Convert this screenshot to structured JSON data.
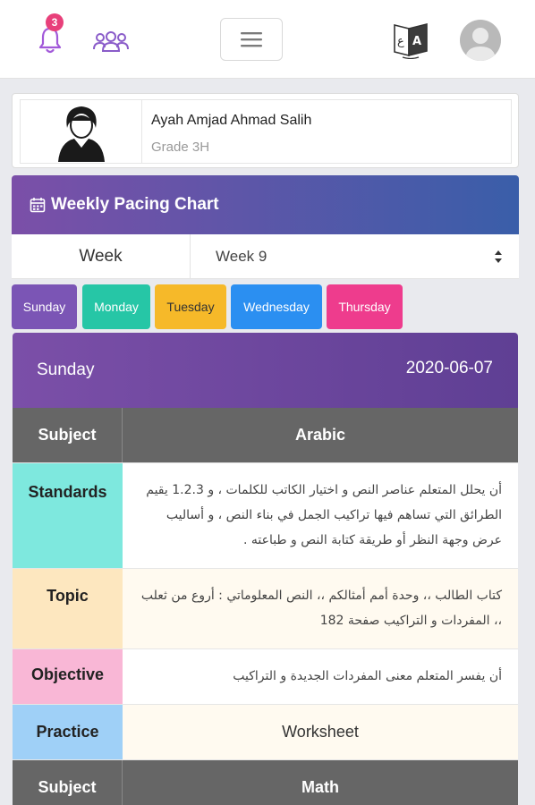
{
  "header": {
    "notification_count": "3",
    "icons": [
      "bell-icon",
      "group-icon",
      "menu-icon",
      "language-icon",
      "avatar-icon"
    ]
  },
  "student": {
    "name": "Ayah Amjad Ahmad Salih",
    "grade": "Grade 3H"
  },
  "chart": {
    "title": "Weekly Pacing Chart",
    "week_label": "Week",
    "week_selected": "Week 9"
  },
  "days": [
    {
      "label": "Sunday",
      "color": "#7b55b5",
      "text_color": "#ffffff"
    },
    {
      "label": "Monday",
      "color": "#26c6a6",
      "text_color": "#ffffff"
    },
    {
      "label": "Tuesday",
      "color": "#f6b929",
      "text_color": "#333333"
    },
    {
      "label": "Wednesday",
      "color": "#2b8ff1",
      "text_color": "#ffffff"
    },
    {
      "label": "Thursday",
      "color": "#ee3c8d",
      "text_color": "#ffffff"
    }
  ],
  "selected_day": {
    "name": "Sunday",
    "date": "2020-06-07",
    "rows": [
      {
        "label": "Subject",
        "value": "Arabic"
      },
      {
        "label": "Standards",
        "value": "أن يحلل المتعلم عناصر النص و اختيار الكاتب للكلمات ، و 1.2.3 يقيم الطرائق التي تساهم فيها تراكيب الجمل في بناء النص ، و أساليب عرض وجهة النظر أو طريقة كتابة النص و طباعته ."
      },
      {
        "label": "Topic",
        "value": "كتاب الطالب ،، وحدة أمم أمثالكم ،، النص المعلوماتي : أروع من ثعلب ،، المفردات و التراكيب صفحة 182"
      },
      {
        "label": "Objective",
        "value": "أن يفسر المتعلم معنى المفردات الجديدة و التراكيب"
      },
      {
        "label": "Practice",
        "value": "Worksheet"
      },
      {
        "label": "Subject",
        "value": "Math"
      }
    ]
  },
  "colors": {
    "standards": "#7ee8de",
    "topic": "#fde7bf",
    "objective": "#f9b7d6",
    "practice": "#9fd0f7",
    "subject": "#666666"
  }
}
